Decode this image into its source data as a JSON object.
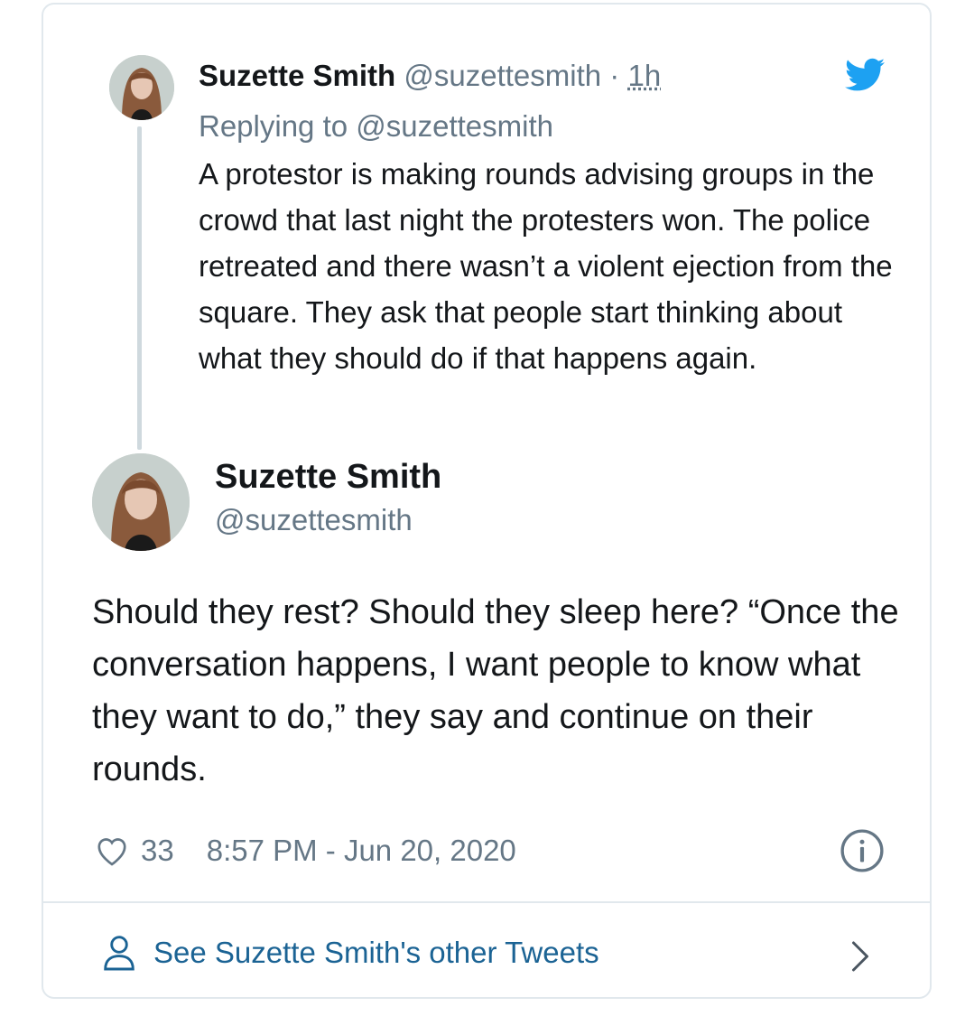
{
  "parent_tweet": {
    "author_name": "Suzette Smith",
    "handle": "@suzettesmith",
    "separator": "·",
    "time": "1h",
    "replying_to": "Replying to @suzettesmith",
    "text": "A protestor is making rounds advising groups in the crowd that last night the protesters won. The police retreated and there wasn’t a violent ejection from the square. They ask that people start thinking about what they should do if that happens again."
  },
  "main_tweet": {
    "author_name": "Suzette Smith",
    "handle": "@suzettesmith",
    "text": "Should they rest? Should they sleep here? “Once the conversation happens, I want people to know what they want to do,” they say and continue on their rounds.",
    "likes": "33",
    "timestamp": "8:57 PM - Jun 20, 2020"
  },
  "footer": {
    "link_label": "See Suzette Smith's other Tweets"
  },
  "icons": {
    "brand": "twitter-bird-icon",
    "like": "heart-icon",
    "info": "info-icon",
    "profile": "user-icon",
    "more": "chevron-right-icon"
  },
  "colors": {
    "twitter_blue": "#1da1f2",
    "secondary_text": "#657786",
    "link": "#1b6394",
    "border": "#e1e8ed"
  }
}
